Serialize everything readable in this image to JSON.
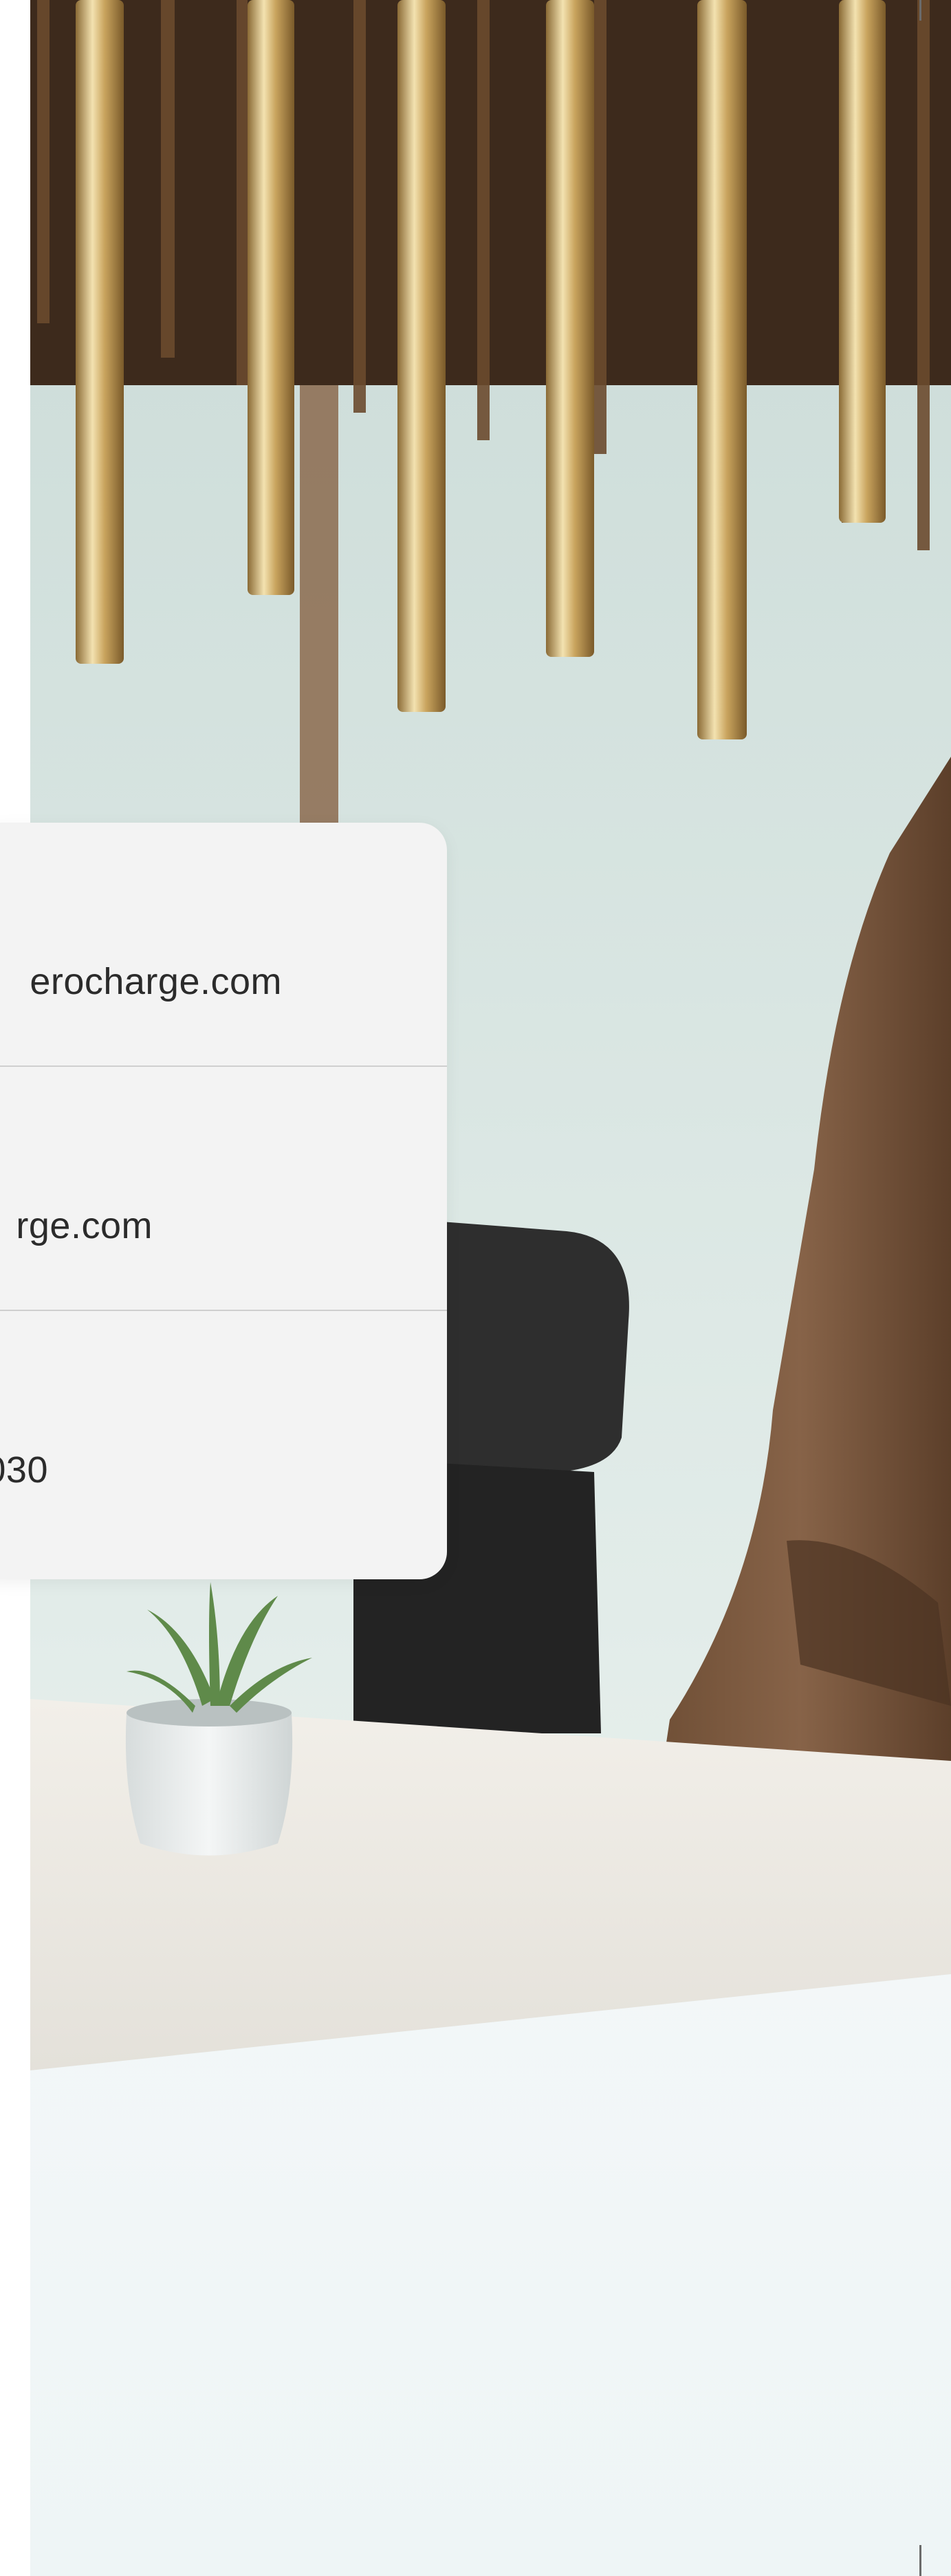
{
  "contact_card": {
    "rows": [
      {
        "value": "erocharge.com"
      },
      {
        "value": "rge.com"
      },
      {
        "value": "030"
      }
    ]
  },
  "photo": {
    "subject": "office-interior-photo"
  },
  "colors": {
    "card_background": "#f3f3f3",
    "divider": "#cfcfcf",
    "text": "#2b2b2b"
  }
}
